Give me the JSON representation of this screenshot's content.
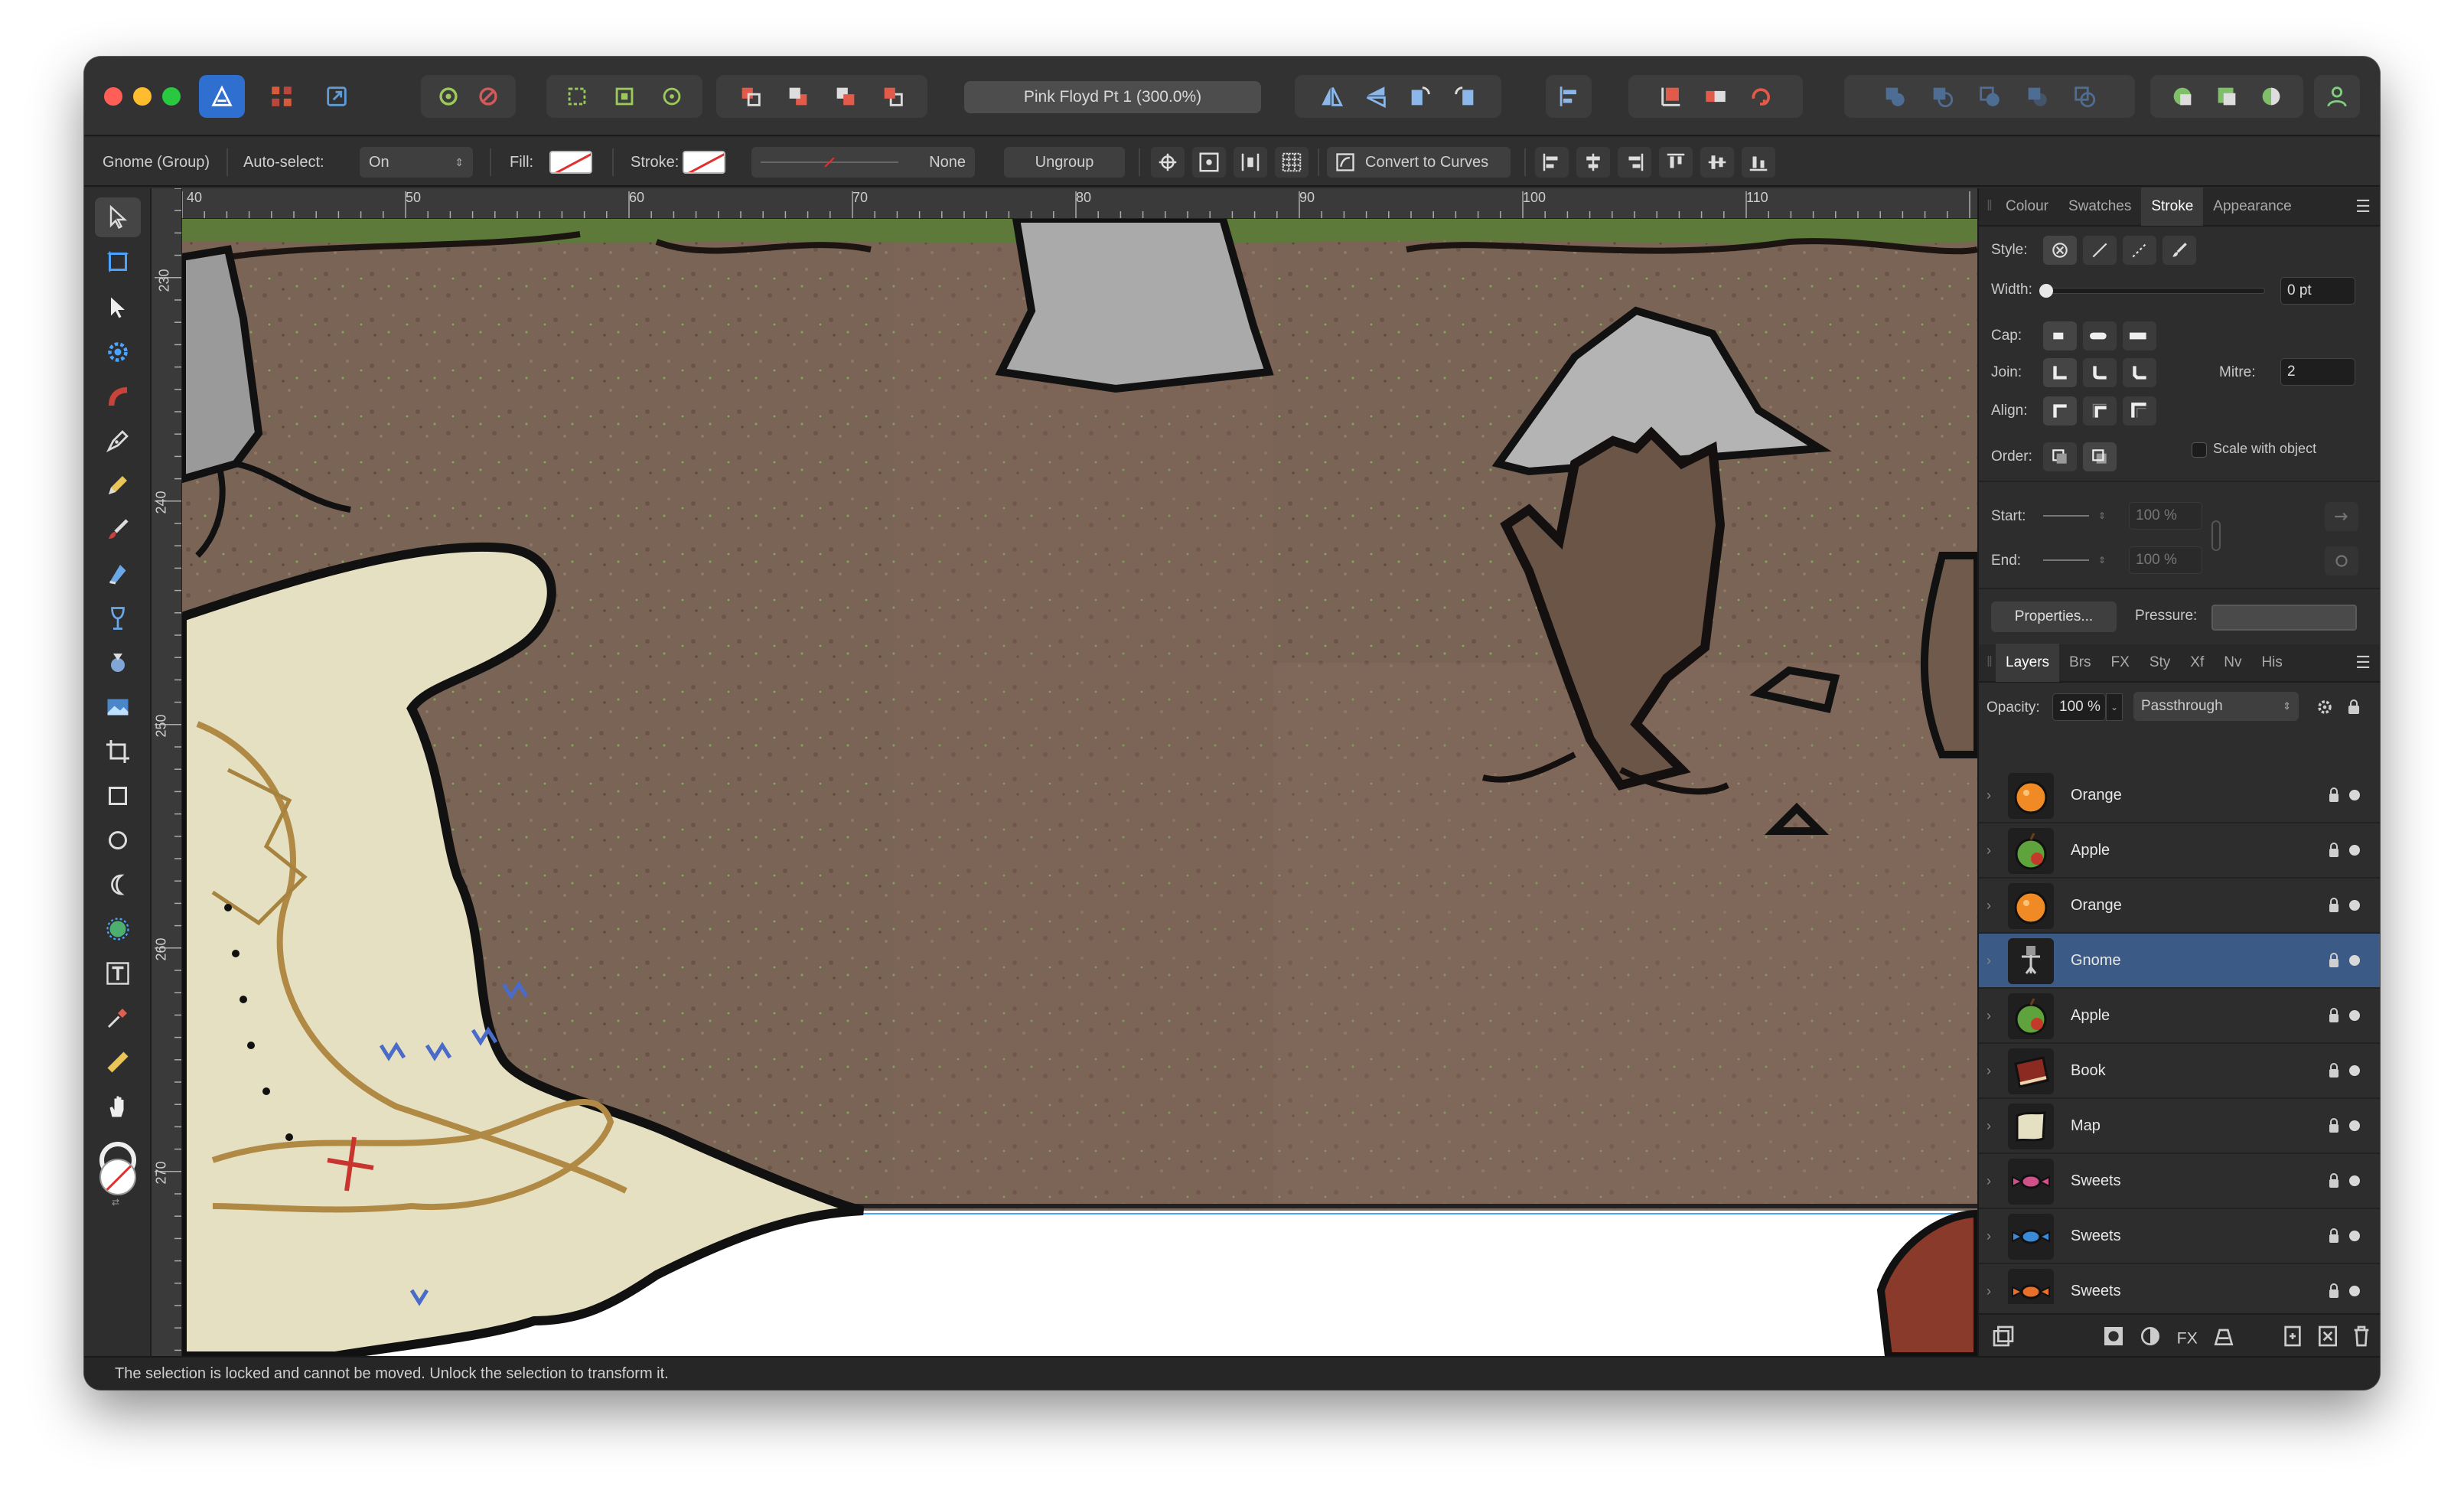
{
  "window": {
    "document_title": "Pink Floyd Pt 1 (300.0%)"
  },
  "context_toolbar": {
    "selection_label": "Gnome (Group)",
    "auto_select_label": "Auto-select:",
    "auto_select_value": "On",
    "fill_label": "Fill:",
    "stroke_label": "Stroke:",
    "stroke_style_value": "None",
    "ungroup_label": "Ungroup",
    "convert_to_curves_label": "Convert to Curves"
  },
  "rulers": {
    "unit": "mm",
    "horizontal_labels": [
      "40",
      "50",
      "60",
      "70",
      "80",
      "90",
      "100",
      "110"
    ],
    "vertical_labels": [
      "230",
      "240",
      "250",
      "260",
      "270"
    ]
  },
  "stroke_panel": {
    "tabs": [
      "Colour",
      "Swatches",
      "Stroke",
      "Appearance"
    ],
    "active_tab": "Stroke",
    "style_label": "Style:",
    "width_label": "Width:",
    "width_value": "0 pt",
    "cap_label": "Cap:",
    "join_label": "Join:",
    "mitre_label": "Mitre:",
    "mitre_value": "2",
    "align_label": "Align:",
    "order_label": "Order:",
    "scale_with_object_label": "Scale with object",
    "start_label": "Start:",
    "start_value": "100 %",
    "end_label": "End:",
    "end_value": "100 %",
    "properties_label": "Properties...",
    "pressure_label": "Pressure:"
  },
  "layers_panel": {
    "tabs": [
      "Layers",
      "Brs",
      "FX",
      "Sty",
      "Xf",
      "Nv",
      "His"
    ],
    "active_tab": "Layers",
    "opacity_label": "Opacity:",
    "opacity_value": "100 %",
    "blend_mode": "Passthrough",
    "items": [
      {
        "name": "Orange",
        "icon": "orange-icon",
        "selected": false
      },
      {
        "name": "Apple",
        "icon": "apple-icon",
        "selected": false
      },
      {
        "name": "Orange",
        "icon": "orange-icon",
        "selected": false
      },
      {
        "name": "Gnome",
        "icon": "gnome-icon",
        "selected": true
      },
      {
        "name": "Apple",
        "icon": "apple-icon",
        "selected": false
      },
      {
        "name": "Book",
        "icon": "book-icon",
        "selected": false
      },
      {
        "name": "Map",
        "icon": "map-icon",
        "selected": false
      },
      {
        "name": "Sweets",
        "icon": "sweets-icon",
        "selected": false
      },
      {
        "name": "Sweets",
        "icon": "sweets-icon",
        "selected": false
      },
      {
        "name": "Sweets",
        "icon": "sweets-icon",
        "selected": false
      }
    ]
  },
  "colors": {
    "selection_blue": "#3c5a86",
    "accent": "#4aa3ff",
    "dirt": "#7a6455"
  },
  "status_bar": {
    "message": "The selection is locked and cannot be moved. Unlock the selection to transform it."
  }
}
